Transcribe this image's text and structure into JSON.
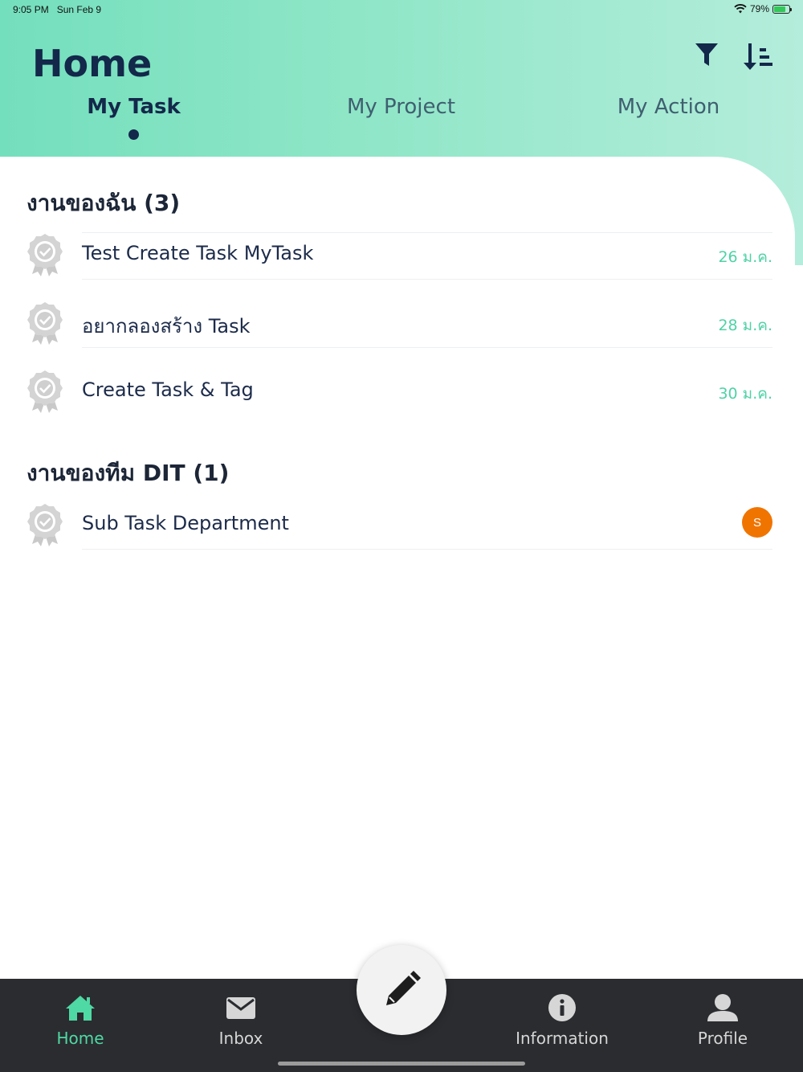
{
  "status": {
    "time": "9:05 PM",
    "date": "Sun Feb 9",
    "battery": "79%",
    "battery_level": 0.79
  },
  "header": {
    "title": "Home",
    "tabs": [
      {
        "label": "My Task",
        "active": true
      },
      {
        "label": "My Project",
        "active": false
      },
      {
        "label": "My Action",
        "active": false
      }
    ]
  },
  "sections": [
    {
      "title": "งานของฉัน (3)",
      "tasks": [
        {
          "title": "Test Create Task MyTask",
          "date": "26 ม.ค."
        },
        {
          "title": "อยากลองสร้าง Task",
          "date": "28 ม.ค."
        },
        {
          "title": "Create Task & Tag",
          "date": "30 ม.ค."
        }
      ]
    },
    {
      "title": "งานของทีม DIT (1)",
      "tasks": [
        {
          "title": "Sub Task Department",
          "assignee": "S"
        }
      ]
    }
  ],
  "bottom_nav": {
    "items": [
      {
        "label": "Home",
        "icon": "home-icon",
        "active": true
      },
      {
        "label": "Inbox",
        "icon": "mail-icon",
        "active": false
      },
      {
        "label": "Information",
        "icon": "info-icon",
        "active": false
      },
      {
        "label": "Profile",
        "icon": "person-icon",
        "active": false
      }
    ],
    "fab_icon": "pencil-icon"
  },
  "colors": {
    "accent": "#4fd9a4",
    "navy": "#13284a",
    "avatar": "#f07400",
    "nav_bg": "#2a2c2f"
  }
}
